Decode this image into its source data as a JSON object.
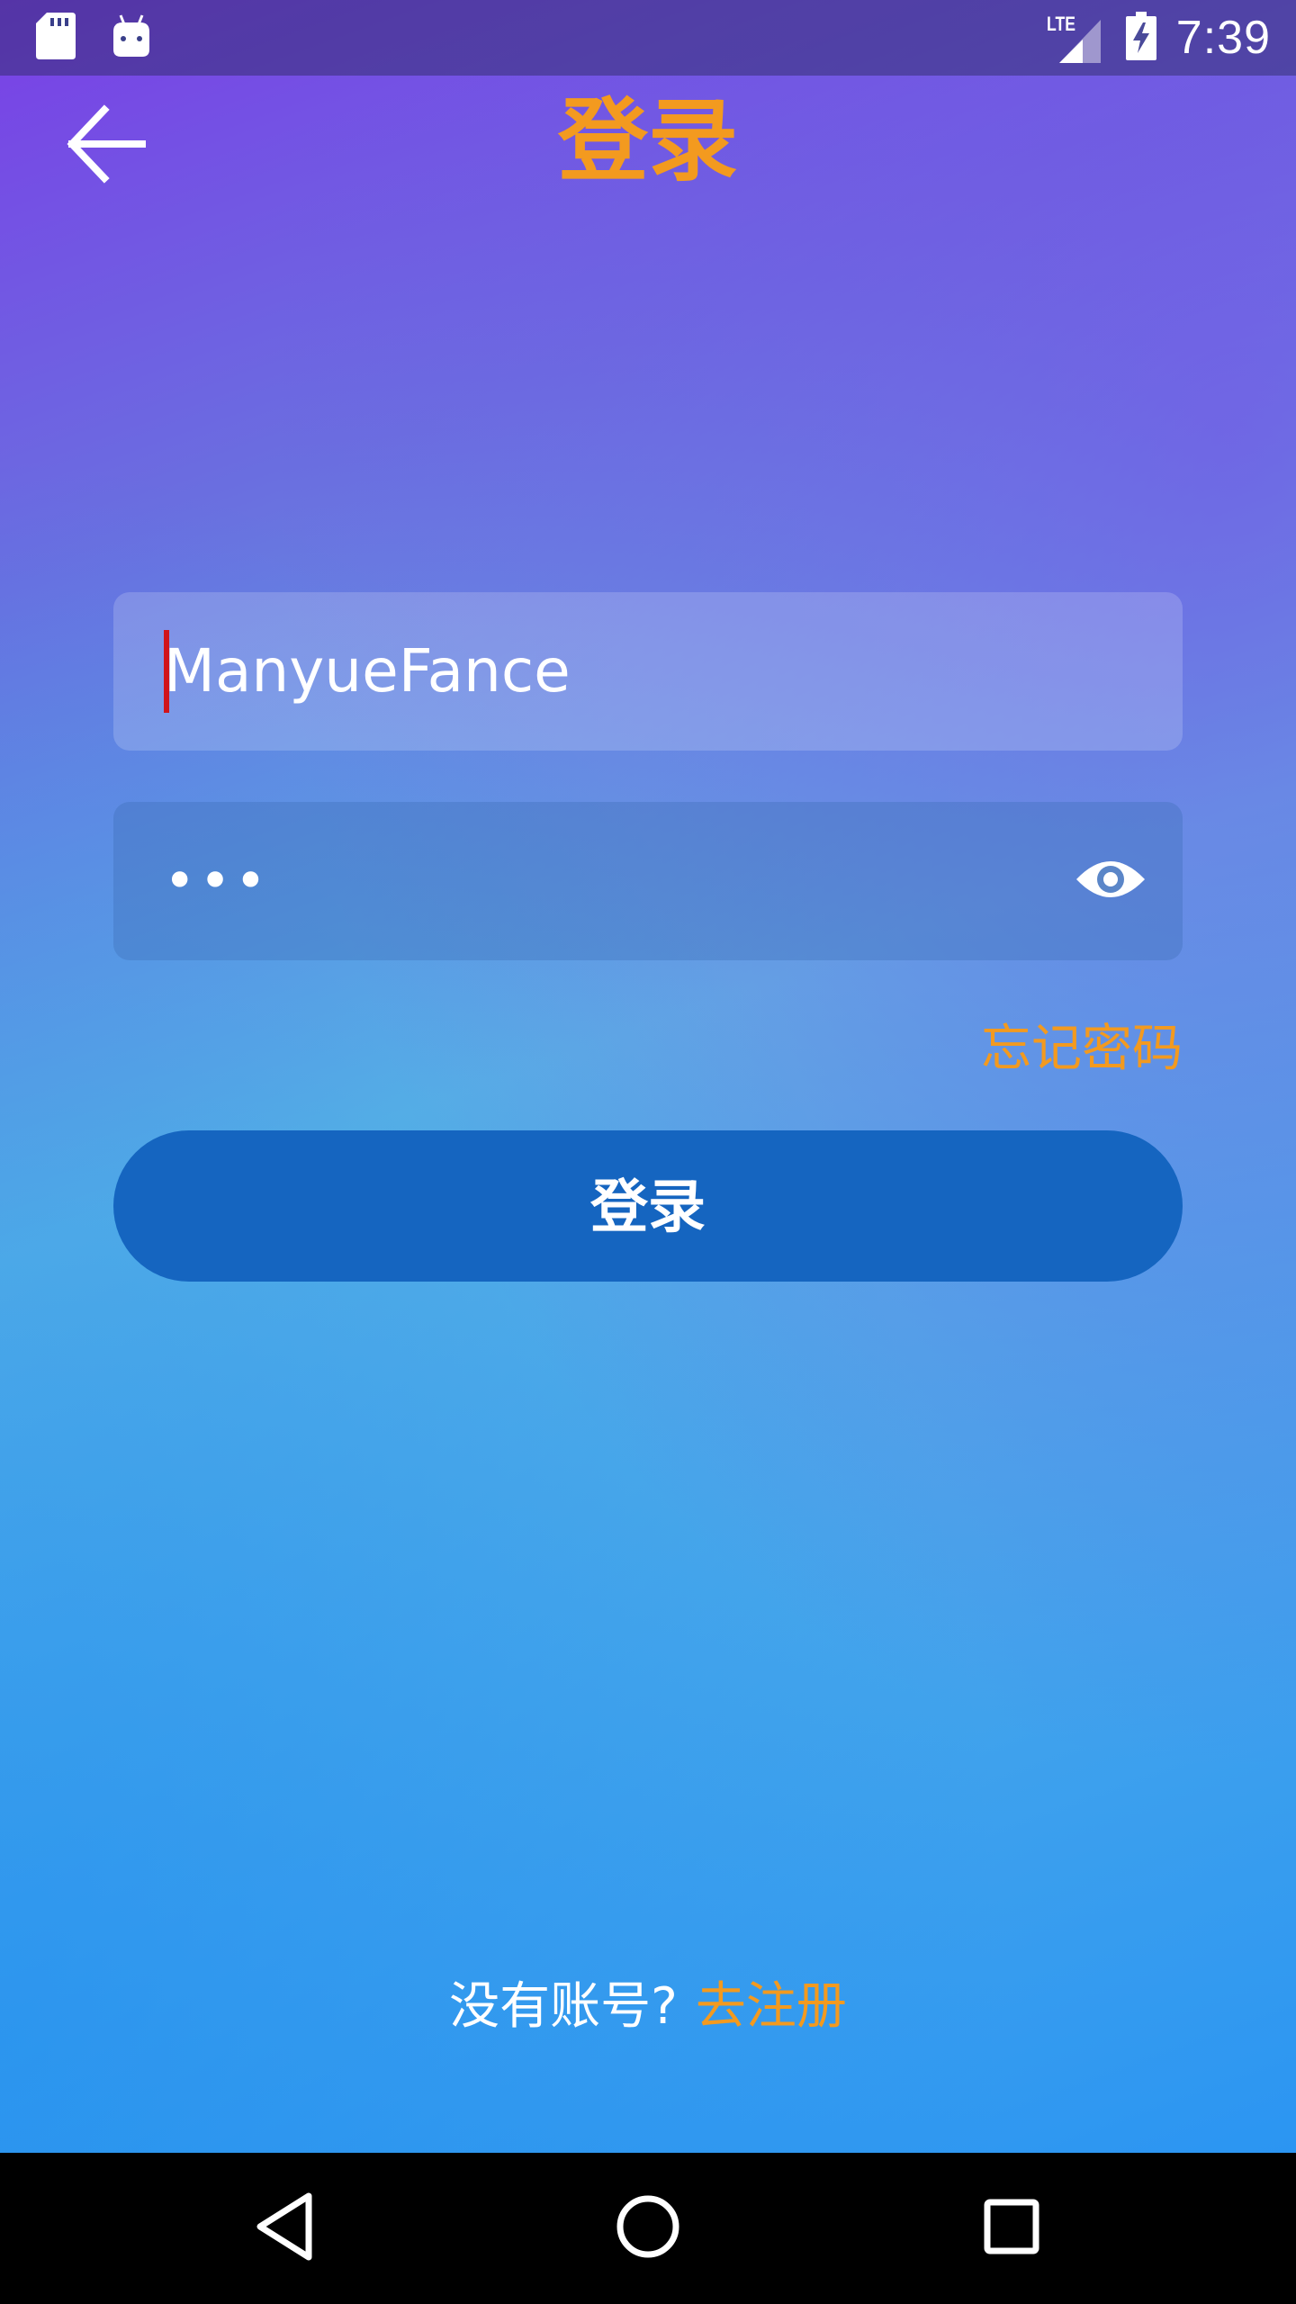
{
  "status_bar": {
    "time": "7:39",
    "network_label": "LTE",
    "icons": [
      "sd-card-icon",
      "android-debug-icon",
      "signal-lte-icon",
      "battery-charging-icon"
    ]
  },
  "toolbar": {
    "title": "登录",
    "back_icon": "arrow-back-icon",
    "title_color": "#f39a1f"
  },
  "form": {
    "username_value": "ManyueFance",
    "password_masked": "•••",
    "password_toggle_icon": "eye-icon",
    "forgot_password": "忘记密码",
    "login_button": "登录",
    "button_color": "#1565c0"
  },
  "footer": {
    "no_account_prompt": "没有账号?",
    "register_link": "去注册"
  },
  "nav_bar": {
    "icons": [
      "nav-back-icon",
      "nav-home-icon",
      "nav-recents-icon"
    ]
  },
  "colors": {
    "accent": "#f39a1f",
    "primary": "#1565c0",
    "cursor": "#d0141b"
  }
}
